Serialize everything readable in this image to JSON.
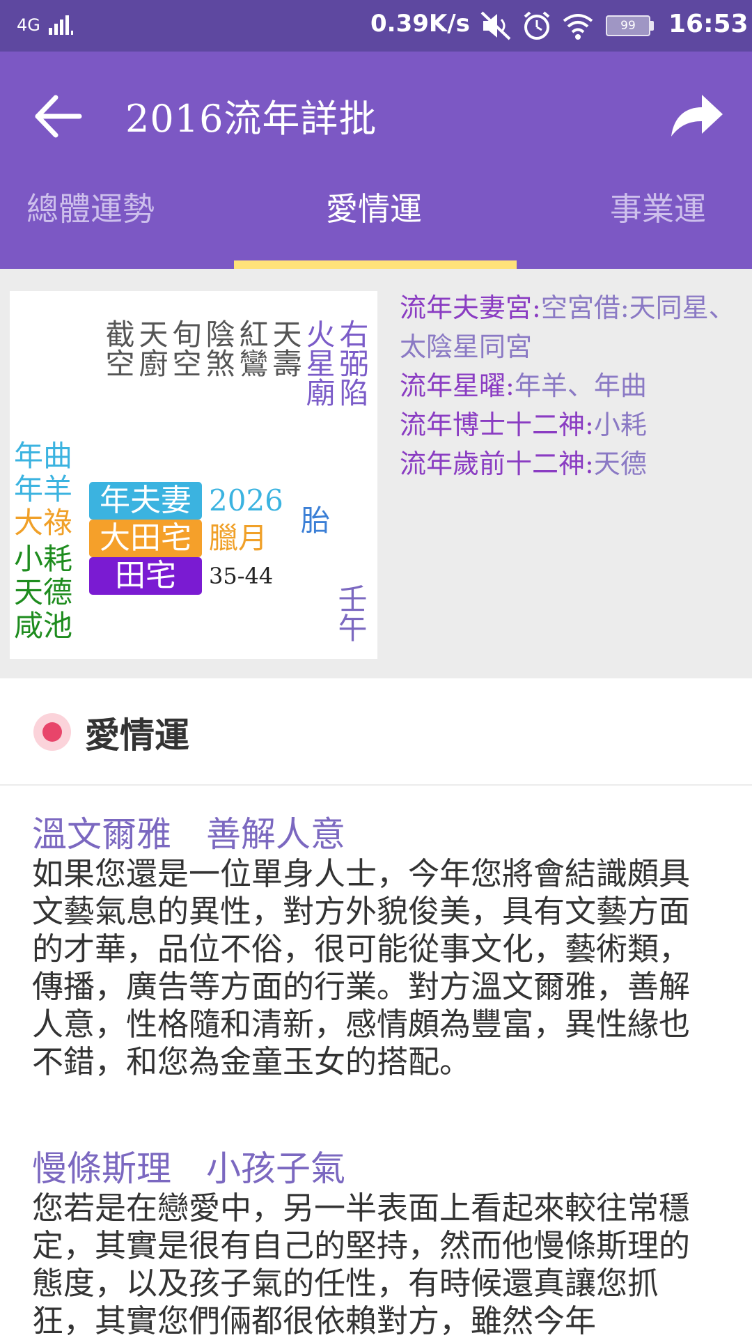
{
  "status_bar": {
    "network": "4G",
    "speed": "0.39K/s",
    "battery": "99",
    "time": "16:53"
  },
  "header": {
    "title": "2016流年詳批",
    "back_icon": "arrow-left-icon",
    "share_icon": "share-arrow-icon"
  },
  "tabs": [
    {
      "label": "總體運勢",
      "selected": false
    },
    {
      "label": "愛情運",
      "selected": true
    },
    {
      "label": "事業運",
      "selected": false
    }
  ],
  "colors": {
    "header_bg": "#7c58c4",
    "status_bg": "#5e48a0",
    "tab_indicator": "#ffe27a",
    "accent_title": "#7b68c0",
    "section_icon": "#e8456a"
  },
  "palace": {
    "top_stars": [
      {
        "text": "截空",
        "color": "#555555"
      },
      {
        "text": "天廚",
        "color": "#555555"
      },
      {
        "text": "旬空",
        "color": "#555555"
      },
      {
        "text": "陰煞",
        "color": "#555555"
      },
      {
        "text": "紅鸞",
        "color": "#555555"
      },
      {
        "text": "天壽",
        "color": "#555555"
      },
      {
        "text": "火星廟",
        "color": "#7b5cc8"
      },
      {
        "text": "右弼陷",
        "color": "#7b5cc8"
      }
    ],
    "status_row": {
      "miao": "廟",
      "xian": "陷"
    },
    "left_stars": [
      {
        "text": "年曲",
        "color": "#3bb3e0"
      },
      {
        "text": "年羊",
        "color": "#3bb3e0"
      },
      {
        "text": "大祿",
        "color": "#f0a028"
      },
      {
        "text": "小耗",
        "color": "#1e8c1e"
      },
      {
        "text": "天德",
        "color": "#1e8c1e"
      },
      {
        "text": "咸池",
        "color": "#1e8c1e"
      }
    ],
    "tags": [
      {
        "label": "年夫妻",
        "bg": "#3bb3e0",
        "side": "2026",
        "side_color": "#3bb3e0"
      },
      {
        "label": "大田宅",
        "bg": "#f5a02a",
        "side": "臘月",
        "side_color": "#f0a028"
      },
      {
        "label": "田宅",
        "bg": "#7a1bd2",
        "side": "35-44",
        "side_color": "#222222"
      }
    ],
    "tai": "胎",
    "ganzhi": "壬午"
  },
  "side_info": [
    {
      "key": "流年夫妻宮:",
      "value": "空宮借:天同星、太陰星同宮"
    },
    {
      "key": "流年星曜:",
      "value": "年羊、年曲"
    },
    {
      "key": "流年博士十二神:",
      "value": "小耗"
    },
    {
      "key": "流年歲前十二神:",
      "value": "天德"
    }
  ],
  "section": {
    "title": "愛情運",
    "icon": "radio-dot-icon"
  },
  "paragraphs": [
    {
      "title": "溫文爾雅　善解人意",
      "body": "如果您還是一位單身人士，今年您將會結識頗具文藝氣息的異性，對方外貌俊美，具有文藝方面的才華，品位不俗，很可能從事文化，藝術類，傳播，廣告等方面的行業。對方溫文爾雅，善解人意，性格隨和清新，感情頗為豐富，異性緣也不錯，和您為金童玉女的搭配。"
    },
    {
      "title": "慢條斯理　小孩子氣",
      "body": "您若是在戀愛中，另一半表面上看起來較往常穩定，其實是很有自己的堅持，然而他慢條斯理的態度，以及孩子氣的任性，有時候還真讓您抓狂，其實您們倆都很依賴對方，雖然今年"
    }
  ]
}
